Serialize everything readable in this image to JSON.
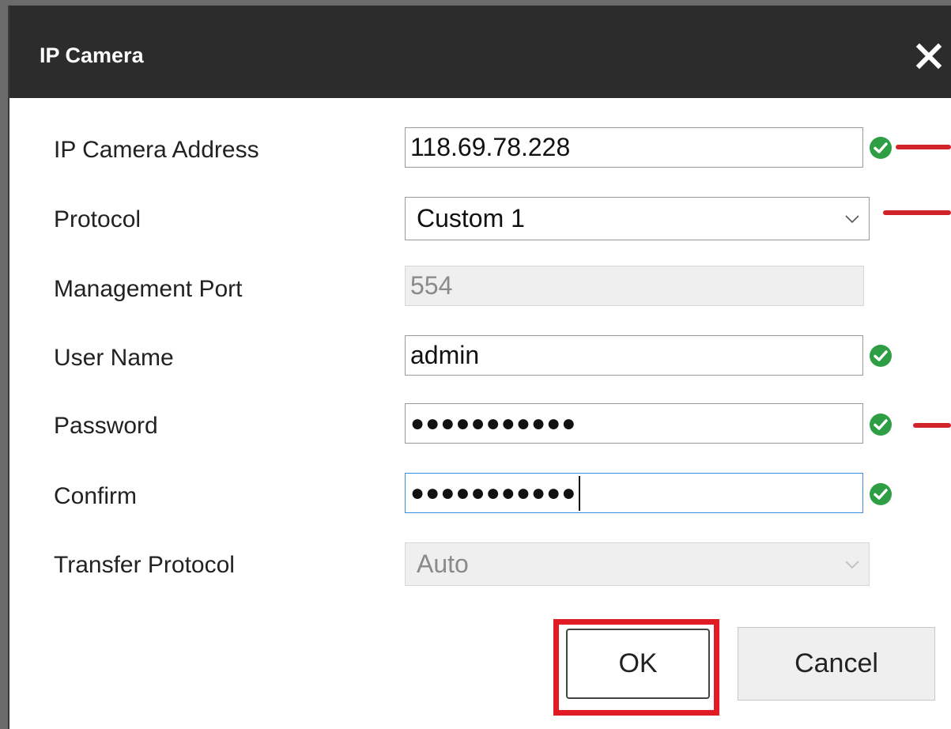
{
  "dialog": {
    "title": "IP Camera",
    "close_icon": "close-icon"
  },
  "form": {
    "ip_address": {
      "label": "IP Camera Address",
      "value": "118.69.78.228",
      "status": "valid"
    },
    "protocol": {
      "label": "Protocol",
      "value": "Custom 1"
    },
    "management_port": {
      "label": "Management Port",
      "value": "554",
      "disabled": true
    },
    "user_name": {
      "label": "User Name",
      "value": "admin",
      "status": "valid"
    },
    "password": {
      "label": "Password",
      "value": "●●●●●●●●●●●",
      "status": "valid"
    },
    "confirm": {
      "label": "Confirm",
      "value": "●●●●●●●●●●●",
      "status": "valid"
    },
    "transfer_protocol": {
      "label": "Transfer Protocol",
      "value": "Auto",
      "disabled": true
    }
  },
  "buttons": {
    "ok": "OK",
    "cancel": "Cancel"
  },
  "colors": {
    "titlebar": "#2c2c2c",
    "valid": "#2e9e44",
    "highlight": "#e01b24",
    "annotation": "#d2222a"
  }
}
